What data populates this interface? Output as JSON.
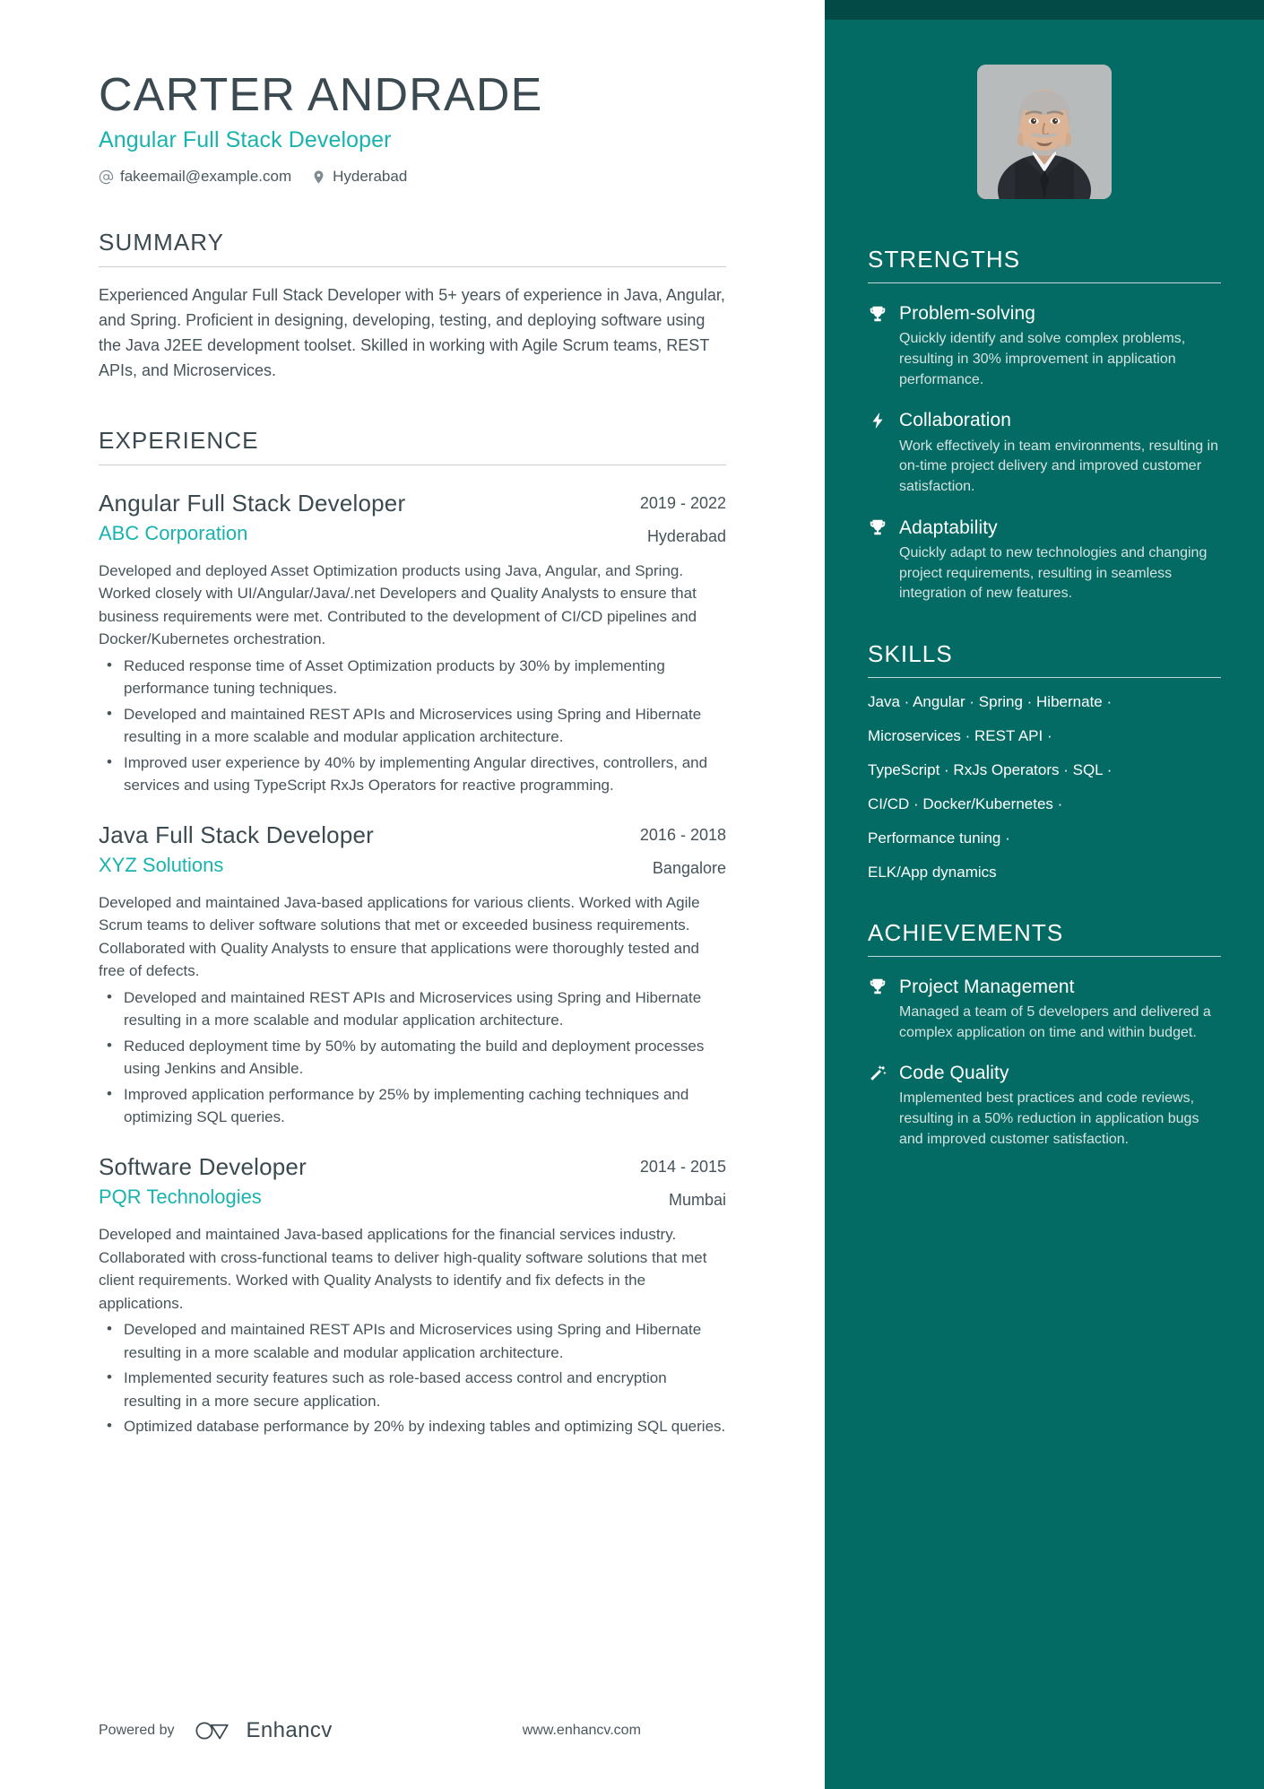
{
  "header": {
    "name": "CARTER ANDRADE",
    "headline": "Angular Full Stack Developer",
    "email": "fakeemail@example.com",
    "location": "Hyderabad",
    "email_icon": "at-icon",
    "location_icon": "map-pin-icon"
  },
  "summary": {
    "title": "SUMMARY",
    "text": "Experienced Angular Full Stack Developer with 5+ years of experience in Java, Angular, and Spring. Proficient in designing, developing, testing, and deploying software using the Java J2EE development toolset. Skilled in working with Agile Scrum teams, REST APIs, and Microservices."
  },
  "experience": {
    "title": "EXPERIENCE",
    "entries": [
      {
        "role": "Angular Full Stack Developer",
        "company": "ABC Corporation",
        "dates": "2019 - 2022",
        "location": "Hyderabad",
        "description": "Developed and deployed Asset Optimization products using Java, Angular, and Spring. Worked closely with UI/Angular/Java/.net Developers and Quality Analysts to ensure that business requirements were met. Contributed to the development of CI/CD pipelines and Docker/Kubernetes orchestration.",
        "bullets": [
          "Reduced response time of Asset Optimization products by 30% by implementing performance tuning techniques.",
          "Developed and maintained REST APIs and Microservices using Spring and Hibernate resulting in a more scalable and modular application architecture.",
          "Improved user experience by 40% by implementing Angular directives, controllers, and services and using TypeScript RxJs Operators for reactive programming."
        ]
      },
      {
        "role": "Java Full Stack Developer",
        "company": "XYZ Solutions",
        "dates": "2016 - 2018",
        "location": "Bangalore",
        "description": "Developed and maintained Java-based applications for various clients. Worked with Agile Scrum teams to deliver software solutions that met or exceeded business requirements. Collaborated with Quality Analysts to ensure that applications were thoroughly tested and free of defects.",
        "bullets": [
          "Developed and maintained REST APIs and Microservices using Spring and Hibernate resulting in a more scalable and modular application architecture.",
          "Reduced deployment time by 50% by automating the build and deployment processes using Jenkins and Ansible.",
          "Improved application performance by 25% by implementing caching techniques and optimizing SQL queries."
        ]
      },
      {
        "role": "Software Developer",
        "company": "PQR Technologies",
        "dates": "2014 - 2015",
        "location": "Mumbai",
        "description": "Developed and maintained Java-based applications for the financial services industry. Collaborated with cross-functional teams to deliver high-quality software solutions that met client requirements. Worked with Quality Analysts to identify and fix defects in the applications.",
        "bullets": [
          "Developed and maintained REST APIs and Microservices using Spring and Hibernate resulting in a more scalable and modular application architecture.",
          "Implemented security features such as role-based access control and encryption resulting in a more secure application.",
          "Optimized database performance by 20% by indexing tables and optimizing SQL queries."
        ]
      }
    ]
  },
  "strengths": {
    "title": "STRENGTHS",
    "items": [
      {
        "icon": "trophy-icon",
        "title": "Problem-solving",
        "description": "Quickly identify and solve complex problems, resulting in 30% improvement in application performance."
      },
      {
        "icon": "lightning-bolt-icon",
        "title": "Collaboration",
        "description": "Work effectively in team environments, resulting in on-time project delivery and improved customer satisfaction."
      },
      {
        "icon": "trophy-icon",
        "title": "Adaptability",
        "description": "Quickly adapt to new technologies and changing project requirements, resulting in seamless integration of new features."
      }
    ]
  },
  "skills": {
    "title": "SKILLS",
    "lines": [
      "Java · Angular · Spring · Hibernate ·",
      "Microservices · REST API ·",
      "TypeScript · RxJs Operators · SQL ·",
      "CI/CD · Docker/Kubernetes ·",
      "Performance tuning ·",
      "ELK/App dynamics"
    ]
  },
  "achievements": {
    "title": "ACHIEVEMENTS",
    "items": [
      {
        "icon": "trophy-icon",
        "title": "Project Management",
        "description": "Managed a team of 5 developers and delivered a complex application on time and within budget."
      },
      {
        "icon": "magic-wand-icon",
        "title": "Code Quality",
        "description": "Implemented best practices and code reviews, resulting in a 50% reduction in application bugs and improved customer satisfaction."
      }
    ]
  },
  "footer": {
    "powered_by": "Powered by",
    "brand": "Enhancv",
    "site": "www.enhancv.com"
  },
  "colors": {
    "accent_teal": "#19b3ae",
    "sidebar_bg": "#046a64",
    "sidebar_cap": "#034a46",
    "text_dark": "#3b4a50"
  }
}
